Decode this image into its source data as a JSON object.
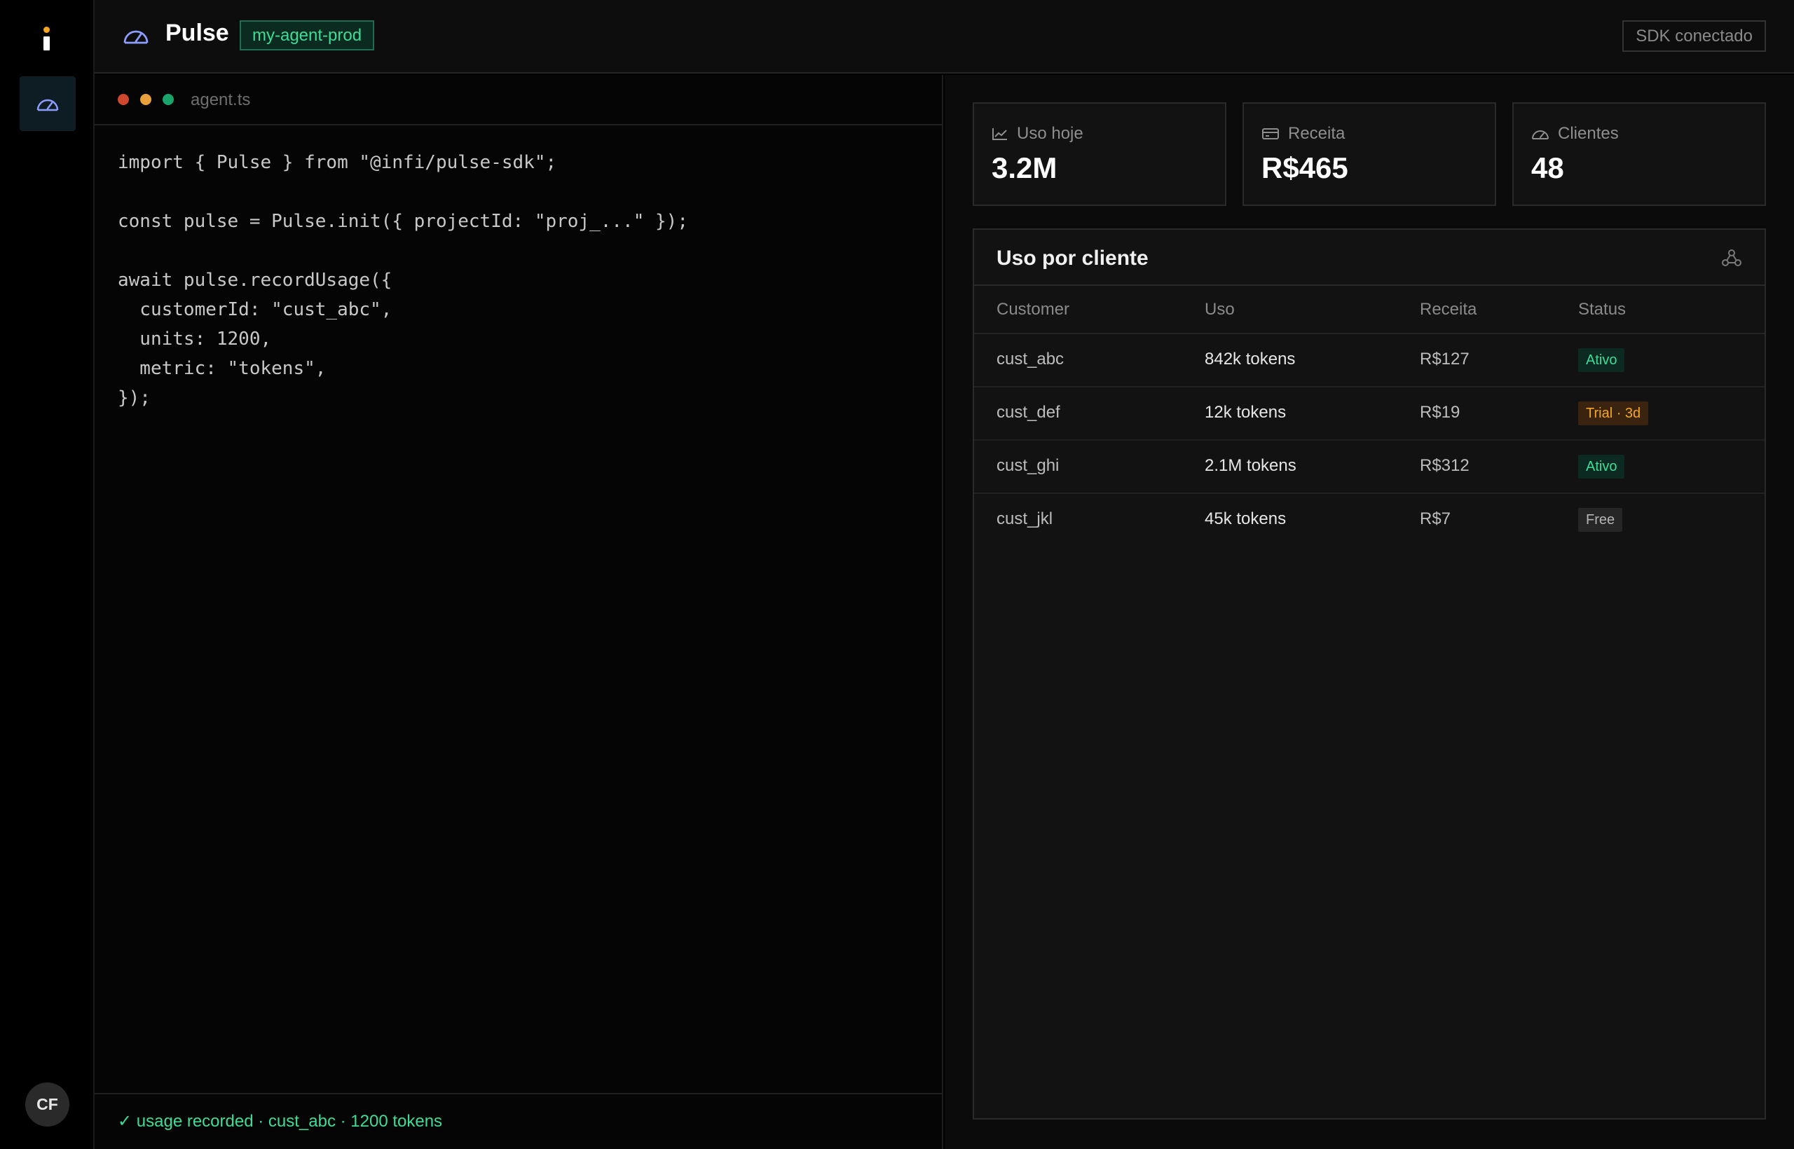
{
  "app": {
    "title": "Pulse",
    "environment": "my-agent-prod",
    "sdk_status": "SDK conectado",
    "user_initials": "CF"
  },
  "sidebar": {
    "items": [
      {
        "icon": "gauge-icon",
        "active": true
      }
    ]
  },
  "code_panel": {
    "file_name": "agent.ts",
    "code": "import { Pulse } from \"@infi/pulse-sdk\";\n\nconst pulse = Pulse.init({ projectId: \"proj_...\" });\n\nawait pulse.recordUsage({\n  customerId: \"cust_abc\",\n  units: 1200,\n  metric: \"tokens\",\n});",
    "log": "✓ usage recorded · cust_abc · 1200 tokens"
  },
  "stats": [
    {
      "icon": "trend-chart-icon",
      "label": "Uso hoje",
      "value": "3.2M"
    },
    {
      "icon": "credit-card-icon",
      "label": "Receita",
      "value": "R$465"
    },
    {
      "icon": "gauge-icon",
      "label": "Clientes",
      "value": "48"
    }
  ],
  "usage_table": {
    "title": "Uso por cliente",
    "columns": [
      "Customer",
      "Uso",
      "Receita",
      "Status"
    ],
    "rows": [
      {
        "customer": "cust_abc",
        "uso": "842k tokens",
        "receita": "R$127",
        "status": "Ativo"
      },
      {
        "customer": "cust_def",
        "uso": "12k tokens",
        "receita": "R$19",
        "status": "Trial · 3d"
      },
      {
        "customer": "cust_ghi",
        "uso": "2.1M tokens",
        "receita": "R$312",
        "status": "Ativo"
      },
      {
        "customer": "cust_jkl",
        "uso": "45k tokens",
        "receita": "R$7",
        "status": "Free"
      }
    ]
  },
  "colors": {
    "accent_green": "#3ddc97",
    "accent_orange": "#f5a623",
    "icon_blue": "#8c9cff"
  }
}
